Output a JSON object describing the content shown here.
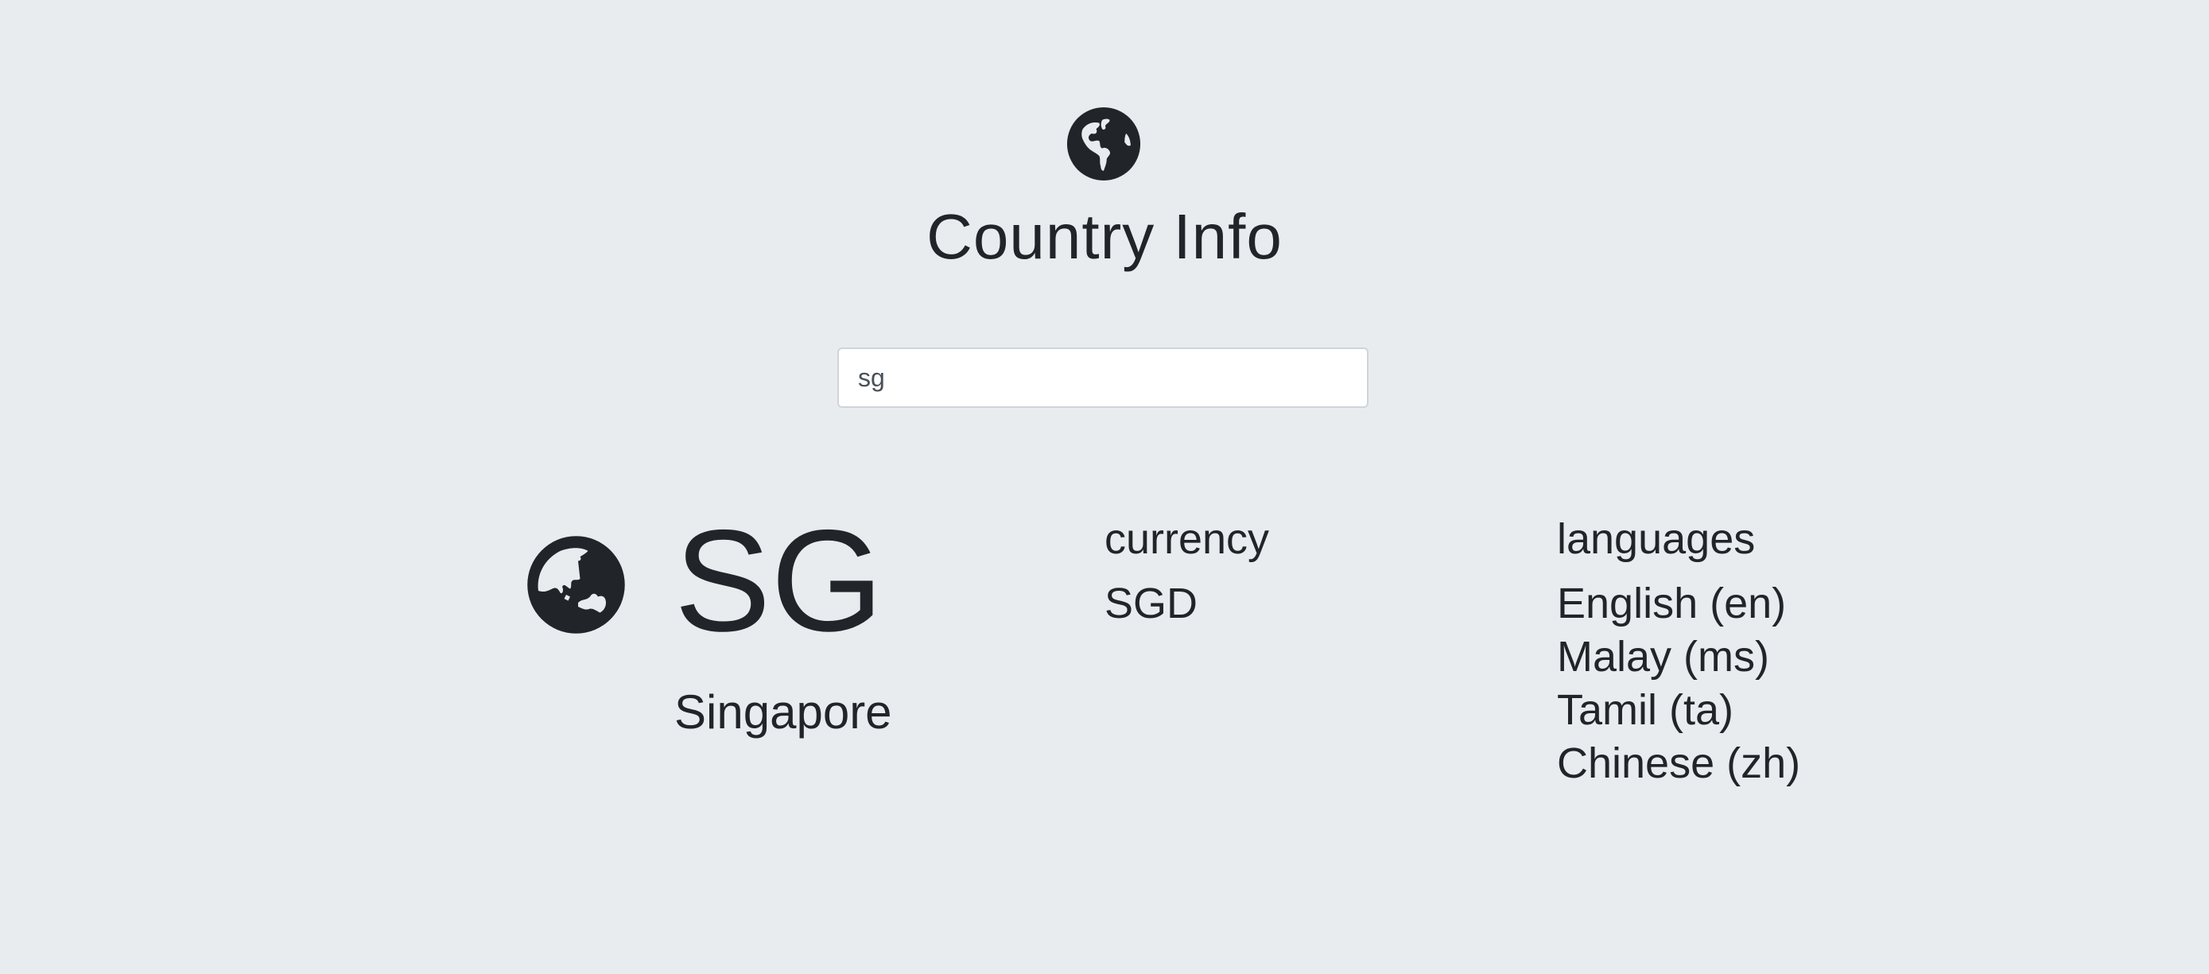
{
  "header": {
    "icon": "globe-americas-icon",
    "title": "Country Info"
  },
  "search": {
    "value": "sg",
    "placeholder": ""
  },
  "result": {
    "icon": "globe-asia-icon",
    "code": "SG",
    "name": "Singapore",
    "currency": {
      "heading": "currency",
      "value": "SGD"
    },
    "languages": {
      "heading": "languages",
      "items": [
        "English (en)",
        "Malay (ms)",
        "Tamil (ta)",
        "Chinese (zh)"
      ]
    }
  },
  "colors": {
    "background": "#e9ecef",
    "text": "#212529",
    "input_border": "#ced4da"
  }
}
